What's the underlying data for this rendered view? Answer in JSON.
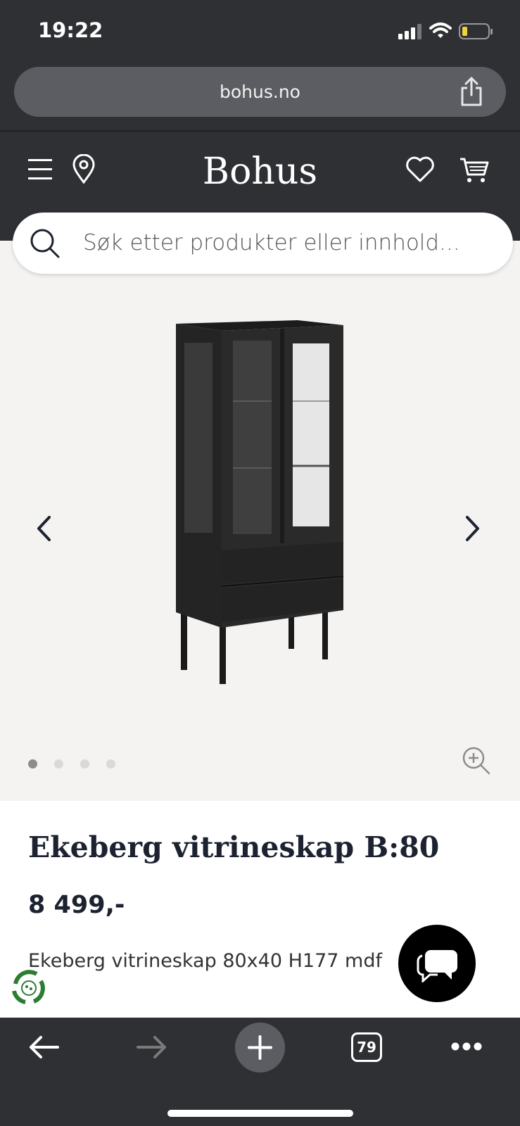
{
  "status_bar": {
    "time": "19:22"
  },
  "browser": {
    "url": "bohus.no",
    "tabs_count": "79"
  },
  "site": {
    "logo": "Bohus",
    "search_placeholder": "Søk etter produkter eller innhold..."
  },
  "gallery": {
    "total_images": 4,
    "active_index": 0
  },
  "product": {
    "title": "Ekeberg vitrineskap B:80",
    "price": "8 499,-",
    "description": "Ekeberg vitrineskap 80x40 H177 mdf"
  },
  "colors": {
    "chrome": "#2f3033",
    "url_bar": "#5b5d62",
    "gallery_bg": "#f4f3f1",
    "text_dark": "#1d2231"
  },
  "icons": [
    "signal-icon",
    "wifi-icon",
    "battery-icon",
    "share-icon",
    "menu-icon",
    "location-pin-icon",
    "heart-icon",
    "cart-icon",
    "search-icon",
    "chevron-left-icon",
    "chevron-right-icon",
    "zoom-in-icon",
    "chat-icon",
    "eco-badge-icon",
    "back-arrow-icon",
    "forward-arrow-icon",
    "new-tab-icon",
    "tabs-icon",
    "more-icon"
  ]
}
